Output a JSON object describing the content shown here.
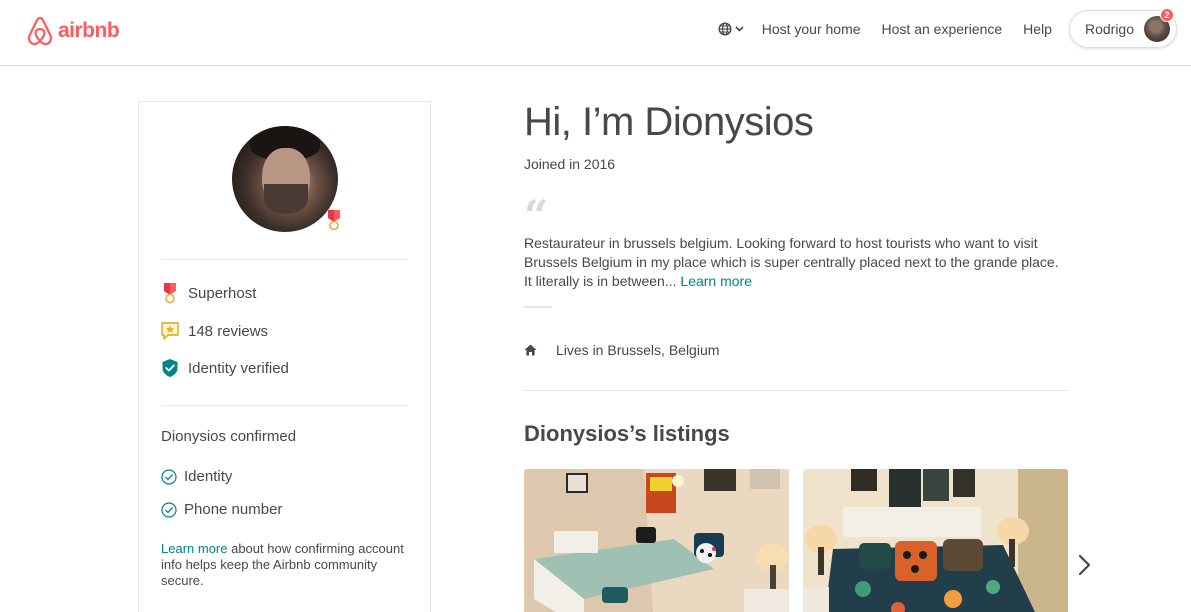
{
  "header": {
    "logo_text": "airbnb",
    "nav": {
      "host_home": "Host your home",
      "host_experience": "Host an experience",
      "help": "Help",
      "user_name": "Rodrigo",
      "notification_count": "2"
    }
  },
  "sidebar": {
    "stats": [
      {
        "label": "Superhost",
        "icon": "superhost-medal-icon"
      },
      {
        "label": "148 reviews",
        "icon": "review-star-icon"
      },
      {
        "label": "Identity verified",
        "icon": "shield-check-icon"
      }
    ],
    "confirmed_title": "Dionysios confirmed",
    "confirmed_items": [
      {
        "label": "Identity"
      },
      {
        "label": "Phone number"
      }
    ],
    "learn_more_link": "Learn more",
    "learn_more_text": " about how confirming account info helps keep the Airbnb community secure."
  },
  "main": {
    "title": "Hi, I’m Dionysios",
    "joined": "Joined in 2016",
    "quote_mark": "“",
    "about_text": "Restaurateur in brussels belgium. Looking forward to host tourists who want to visit Brussels Belgium in my place which is super centrally placed next to the grande place. It literally is in between...",
    "about_more": "Learn more",
    "lives_in": "Lives in Brussels, Belgium",
    "listings_title": "Dionysios’s listings"
  },
  "colors": {
    "brand": "#FF5A5F",
    "link": "#008489",
    "text": "#484848"
  }
}
